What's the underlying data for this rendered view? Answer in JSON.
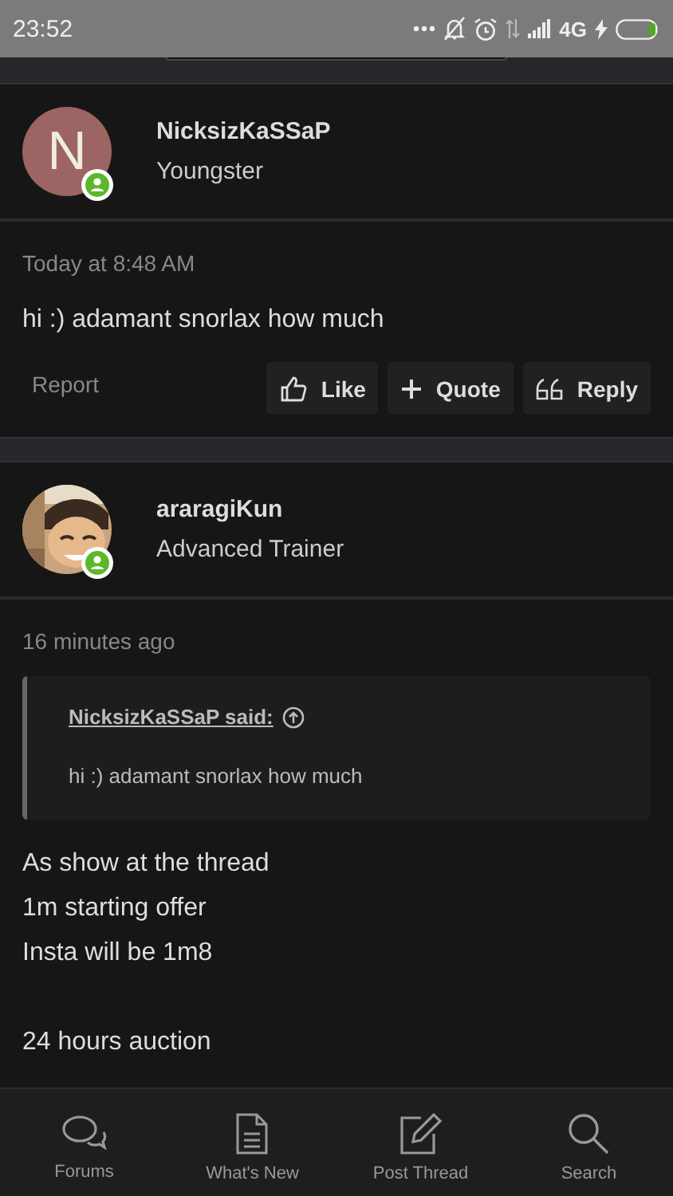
{
  "status_bar": {
    "time": "23:52",
    "network": "4G"
  },
  "posts": [
    {
      "avatar": {
        "kind": "letter",
        "letter": "N",
        "color": "#9c6462"
      },
      "online": true,
      "username": "NicksizKaSSaP",
      "title": "Youngster",
      "time": "Today at 8:48 AM",
      "body": [
        [
          "hi :) adamant snorlax how much"
        ]
      ],
      "report": "Report",
      "actions": [
        {
          "kind": "like",
          "label": "Like"
        },
        {
          "kind": "quote",
          "label": "Quote"
        },
        {
          "kind": "reply",
          "label": "Reply"
        }
      ]
    },
    {
      "avatar": {
        "kind": "picture"
      },
      "online": true,
      "username": "araragiKun",
      "title": "Advanced Trainer",
      "time": "16 minutes ago",
      "quote": {
        "author": "NicksizKaSSaP said:",
        "text": "hi :) adamant snorlax how much"
      },
      "body": [
        [
          "As show at the thread",
          "1m starting offer",
          "Insta will be 1m8"
        ],
        [
          "24 hours auction"
        ]
      ]
    }
  ],
  "bottom_nav": [
    {
      "kind": "forums",
      "label": "Forums"
    },
    {
      "kind": "new",
      "label": "What's New"
    },
    {
      "kind": "post",
      "label": "Post Thread"
    },
    {
      "kind": "search",
      "label": "Search"
    }
  ]
}
